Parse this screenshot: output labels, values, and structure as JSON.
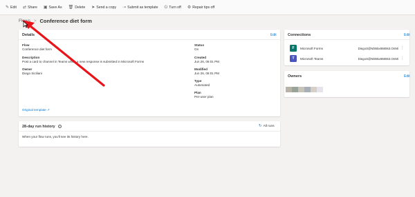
{
  "toolbar": {
    "items": [
      {
        "label": "Edit",
        "icon": "pencil-icon",
        "glyph": "✎"
      },
      {
        "label": "Share",
        "icon": "share-icon",
        "glyph": "⇄"
      },
      {
        "label": "Save As",
        "icon": "save-as-icon",
        "glyph": "▣"
      },
      {
        "label": "Delete",
        "icon": "trash-icon",
        "glyph": "🗑"
      },
      {
        "label": "Send a copy",
        "icon": "send-icon",
        "glyph": "➤"
      },
      {
        "label": "Submit as template",
        "icon": "template-icon",
        "glyph": "⇢"
      },
      {
        "label": "Turn off",
        "icon": "power-icon",
        "glyph": "⏻"
      },
      {
        "label": "Repair tips off",
        "icon": "wrench-icon",
        "glyph": "⚙"
      }
    ]
  },
  "breadcrumb": {
    "parent": "Flows",
    "separator": ">",
    "current": "Conference diet form"
  },
  "details": {
    "title": "Details",
    "edit": "Edit",
    "flow_label": "Flow",
    "flow_value": "Conference diet form",
    "description_label": "Description",
    "description_value": "Post a card to channel in Teams when a new response is submitted in Microsoft Forms",
    "owner_label": "Owner",
    "owner_value": "Diego Siciliani",
    "status_label": "Status",
    "status_value": "On",
    "created_label": "Created",
    "created_value": "Jun 26, 06:01 PM",
    "modified_label": "Modified",
    "modified_value": "Jun 26, 06:01 PM",
    "type_label": "Type",
    "type_value": "Automated",
    "plan_label": "Plan",
    "plan_value": "Per-user plan",
    "original_template": "Original template"
  },
  "history": {
    "title": "28-day run history",
    "all_runs": "All runs",
    "empty_message": "When your flow runs, you'll see its history here."
  },
  "connections": {
    "title": "Connections",
    "edit": "Edit",
    "items": [
      {
        "name": "Microsoft Forms",
        "account": "DiegoS@M365x868063.OnMi",
        "color": "#077568",
        "glyph": "F"
      },
      {
        "name": "Microsoft Teams",
        "account": "DiegoS@M365x868063.OnMi",
        "color": "#4b53bc",
        "glyph": "T"
      }
    ]
  },
  "owners": {
    "title": "Owners",
    "edit": "Edit",
    "avatar_colors": [
      "#b7b3a6",
      "#9aa39a",
      "#c7c3b8",
      "#a8b0b5",
      "#d6cfc7",
      "#e7e3ea"
    ]
  },
  "colors": {
    "accent": "#0078d4",
    "annotation_arrow": "#e8141a"
  }
}
